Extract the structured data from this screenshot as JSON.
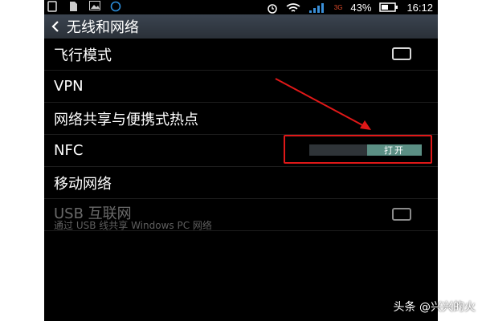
{
  "status_bar": {
    "battery_percent": "43%",
    "time": "16:12",
    "network_label": "3G",
    "icons": [
      "notification-icon",
      "sd-card-icon",
      "image-icon",
      "bluetooth-icon",
      "alarm-icon",
      "wifi-icon",
      "signal-icon",
      "battery-icon"
    ]
  },
  "header": {
    "title": "无线和网络"
  },
  "settings": {
    "airplane_mode": {
      "label": "飞行模式",
      "checked": false
    },
    "vpn": {
      "label": "VPN"
    },
    "tethering": {
      "label": "网络共享与便携式热点"
    },
    "nfc": {
      "label": "NFC",
      "toggle_label": "打开",
      "enabled": true
    },
    "mobile_network": {
      "label": "移动网络"
    },
    "usb_tethering": {
      "label": "USB 互联网",
      "summary": "通过 USB 线共享 Windows PC 网络",
      "checked": false,
      "enabled": false
    }
  },
  "annotation": {
    "color": "#e01818"
  },
  "watermark": {
    "text": "头条 @兴兴的火"
  }
}
